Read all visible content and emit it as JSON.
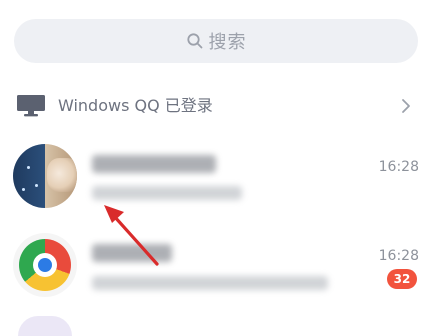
{
  "search": {
    "label": "搜索",
    "icon": "search-icon"
  },
  "pc_status": {
    "text": "Windows QQ 已登录",
    "icon": "monitor-icon",
    "chevron": "chevron-right-icon"
  },
  "chats": [
    {
      "time": "16:28",
      "avatar": "avatar-photo"
    },
    {
      "time": "16:28",
      "unread": "32",
      "avatar": "avatar-app-logo"
    }
  ],
  "colors": {
    "accent_red": "#f2533d",
    "search_bg": "#eef0f4",
    "muted_text": "#8d929b"
  }
}
